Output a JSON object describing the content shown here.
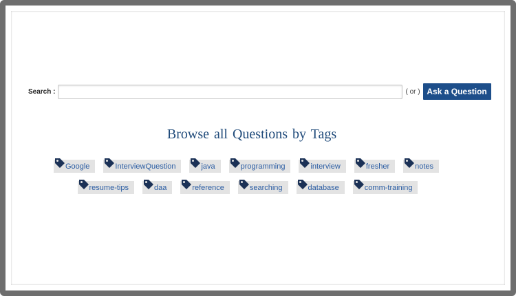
{
  "search": {
    "label": "Search :",
    "value": "",
    "placeholder": "",
    "or_text": "( or )",
    "ask_button_label": "Ask a Question"
  },
  "browse": {
    "heading": "Browse all  Questions by Tags"
  },
  "tags_row1": [
    {
      "label": "Google"
    },
    {
      "label": "InterviewQuestion"
    },
    {
      "label": "java"
    },
    {
      "label": "programming"
    },
    {
      "label": "interview"
    },
    {
      "label": "fresher"
    },
    {
      "label": "notes"
    }
  ],
  "tags_row2": [
    {
      "label": "resume-tips"
    },
    {
      "label": "daa"
    },
    {
      "label": "reference"
    },
    {
      "label": "searching"
    },
    {
      "label": "database"
    },
    {
      "label": "comm-training"
    }
  ],
  "colors": {
    "accent": "#1d4e8a",
    "tag_text": "#2b5da3",
    "tag_bg": "#e3e3e3",
    "tag_icon": "#1b3156",
    "frame": "#6e6e6e"
  },
  "icons": {
    "tag": "tag-icon"
  }
}
